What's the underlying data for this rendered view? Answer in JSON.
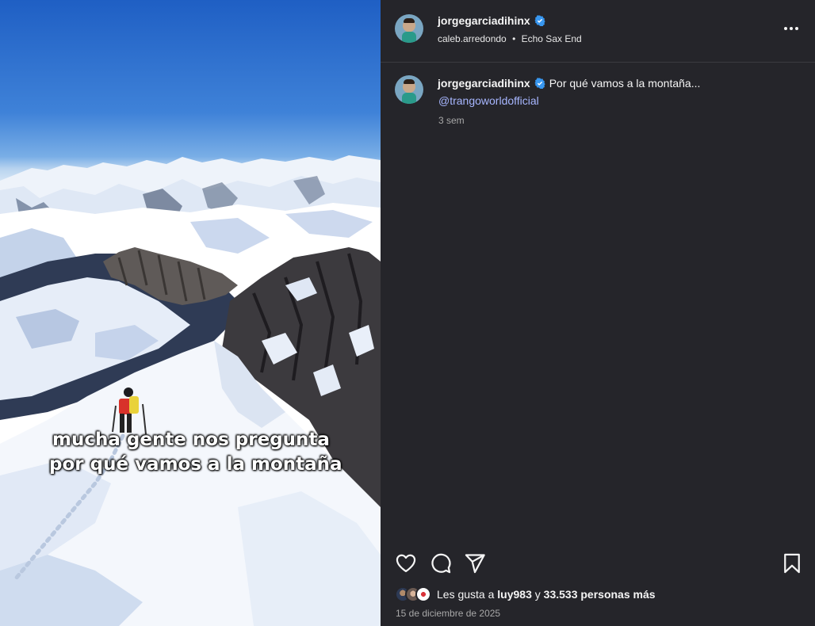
{
  "post": {
    "author": "jorgegarciadihinx",
    "collaborator": "caleb.arredondo",
    "audio": "Echo Sax End",
    "separator": "•",
    "caption_text": "Por qué vamos a la montaña...",
    "caption_mention": "@trangoworldofficial",
    "age": "3 sem",
    "date": "15 de diciembre de 2025"
  },
  "media": {
    "overlay_line1": "mucha gente nos pregunta",
    "overlay_line2": "por qué vamos a la montaña"
  },
  "likes": {
    "prefix": "Les gusta a ",
    "user": "luy983",
    "middle": " y ",
    "count_text": "33.533 personas más"
  },
  "icons": {
    "verified": "verified-badge-icon",
    "more": "more-options-icon",
    "like": "heart-icon",
    "comment": "comment-icon",
    "share": "share-icon",
    "save": "bookmark-icon"
  },
  "colors": {
    "panel_bg": "#25252a",
    "verified": "#3897f0",
    "mention": "#a7b6ff",
    "muted": "#a8a8a8"
  }
}
